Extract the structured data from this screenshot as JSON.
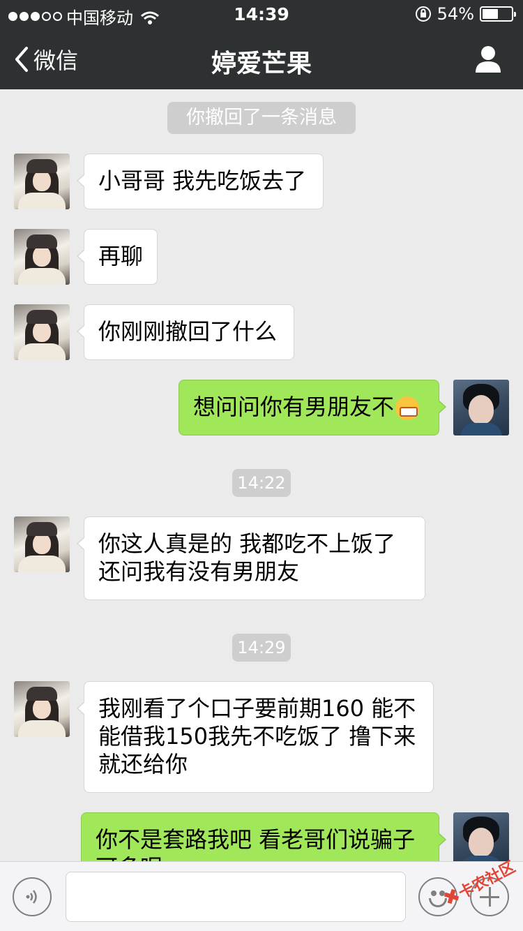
{
  "status_bar": {
    "carrier": "中国移动",
    "time": "14:39",
    "battery": "54%",
    "battery_level": 0.54
  },
  "nav": {
    "back_label": "微信",
    "title": "婷爱芒果",
    "profile_icon": "person-icon"
  },
  "messages": [
    {
      "type": "system",
      "text": "你撤回了一条消息"
    },
    {
      "type": "in",
      "text": "小哥哥 我先吃饭去了"
    },
    {
      "type": "in",
      "text": "再聊"
    },
    {
      "type": "in",
      "text": "你刚刚撤回了什么"
    },
    {
      "type": "out",
      "text": "想问问你有男朋友不",
      "emoji": "grimacing-emoji"
    },
    {
      "type": "time",
      "text": "14:22"
    },
    {
      "type": "in",
      "line1": "你这人真是的  我都吃不上饭了",
      "line2": "还问我有没有男朋友"
    },
    {
      "type": "time",
      "text": "14:29"
    },
    {
      "type": "in",
      "line1": "我刚看了个口子要前期160 能不",
      "line2": "能借我150我先不吃饭了  撸下来",
      "line3": "就还给你"
    },
    {
      "type": "out",
      "line1": "你不是套路我吧  看老哥们说骗子",
      "line2": "可多呢"
    }
  ],
  "input_bar": {
    "voice_icon": "voice-icon",
    "emoji_icon": "smiley-icon",
    "plus_icon": "plus-icon"
  },
  "watermark": {
    "text": "卡农社区"
  },
  "colors": {
    "bar": "#2e3132",
    "background": "#ebebeb",
    "outgoing_bubble": "#a0e75a",
    "incoming_bubble": "#ffffff"
  }
}
